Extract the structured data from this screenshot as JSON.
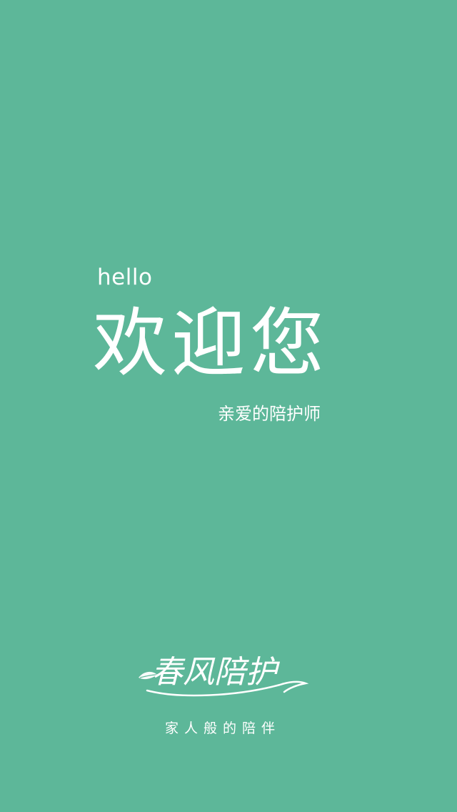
{
  "colors": {
    "background": "#5db799",
    "text": "#ffffff"
  },
  "greeting": {
    "hello": "hello",
    "title": "欢迎您",
    "subtitle": "亲爱的陪护师"
  },
  "brand": {
    "logo_text": "春风陪护",
    "slogan": "家人般的陪伴"
  }
}
